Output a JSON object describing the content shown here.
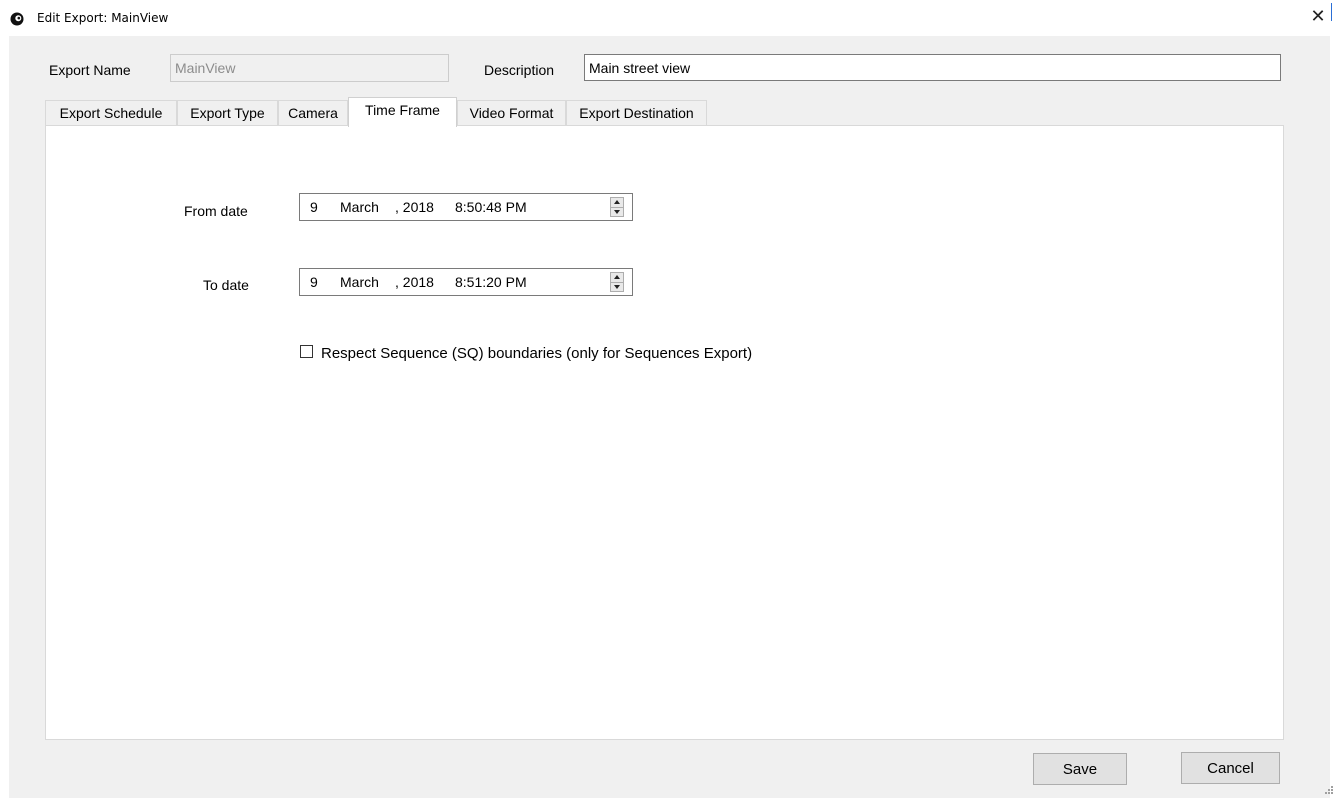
{
  "window": {
    "title": "Edit Export: MainView"
  },
  "form": {
    "export_name_label": "Export Name",
    "export_name_value": "MainView",
    "description_label": "Description",
    "description_value": "Main street view"
  },
  "tabs": [
    {
      "label": "Export Schedule"
    },
    {
      "label": "Export Type"
    },
    {
      "label": "Camera"
    },
    {
      "label": "Time Frame"
    },
    {
      "label": "Video Format"
    },
    {
      "label": "Export Destination"
    }
  ],
  "active_tab": "Time Frame",
  "time_frame": {
    "from": {
      "label": "From date",
      "day": "9",
      "month": "March",
      "year": ", 2018",
      "time": "8:50:48 PM"
    },
    "to": {
      "label": "To date",
      "day": "9",
      "month": "March",
      "year": ", 2018",
      "time": "8:51:20 PM"
    },
    "respect_sq_label": "Respect Sequence (SQ) boundaries (only for Sequences Export)",
    "respect_sq_checked": false
  },
  "buttons": {
    "save": "Save",
    "cancel": "Cancel"
  }
}
